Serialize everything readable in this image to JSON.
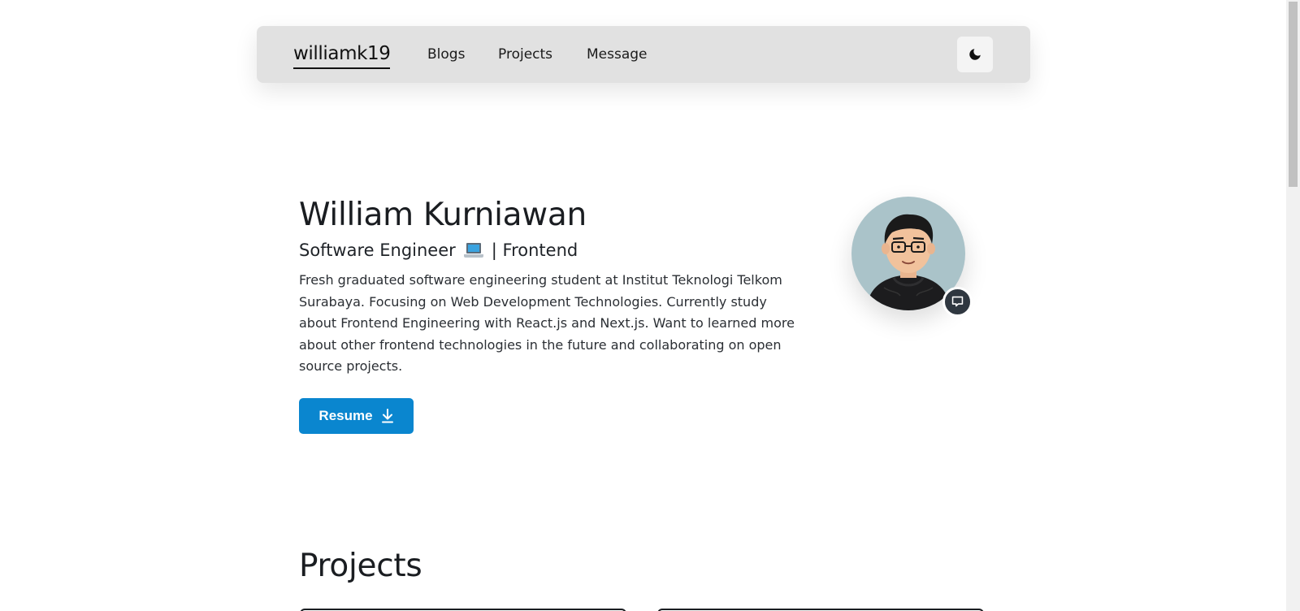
{
  "navbar": {
    "brand": "williamk19",
    "links": [
      "Blogs",
      "Projects",
      "Message"
    ],
    "theme_icon": "moon-icon"
  },
  "hero": {
    "name": "William Kurniawan",
    "subtitle_left": "Software Engineer",
    "subtitle_emoji": "laptop-icon",
    "subtitle_right": "| Frontend",
    "description": "Fresh graduated software engineering student at Institut Teknologi Telkom Surabaya. Focusing on Web Development Technologies. Currently study about Frontend Engineering with React.js and Next.js. Want to learned more about other frontend technologies in the future and collaborating on open source projects.",
    "resume_label": "Resume",
    "resume_icon": "download-icon",
    "avatar_icon": "avatar",
    "chat_icon": "chat-icon"
  },
  "projects": {
    "heading": "Projects"
  },
  "colors": {
    "navbar_bg": "#e1e1e1",
    "accent": "#0a86cf",
    "avatar_bg": "#aac3c9",
    "badge_bg": "#2f3740"
  }
}
